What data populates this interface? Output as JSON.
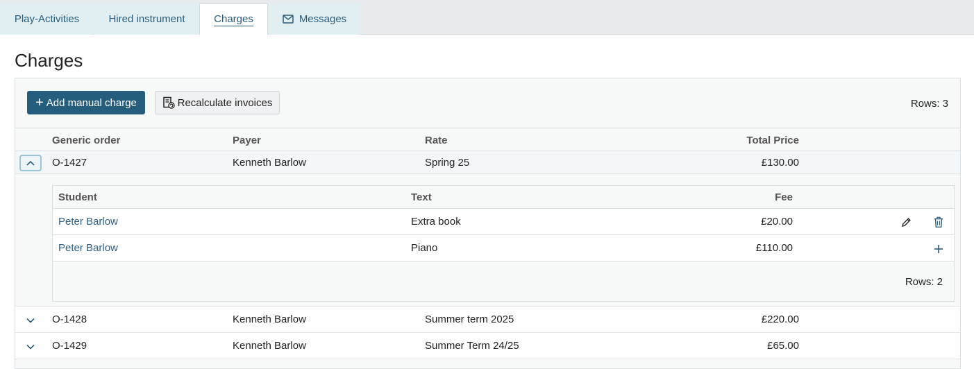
{
  "tabs": [
    {
      "label": "Play-Activities"
    },
    {
      "label": "Hired instrument"
    },
    {
      "label": "Charges"
    },
    {
      "label": "Messages"
    }
  ],
  "page": {
    "title": "Charges"
  },
  "toolbar": {
    "add_label": "Add manual charge",
    "recalc_label": "Recalculate invoices",
    "rows_count": "Rows: 3"
  },
  "table": {
    "headers": [
      "Generic order",
      "Payer",
      "Rate",
      "Total Price"
    ],
    "rows": [
      {
        "order": "O-1427",
        "payer": "Kenneth Barlow",
        "rate": "Spring 25",
        "total": "£130.00"
      },
      {
        "order": "O-1428",
        "payer": "Kenneth Barlow",
        "rate": "Summer term 2025",
        "total": "£220.00"
      },
      {
        "order": "O-1429",
        "payer": "Kenneth Barlow",
        "rate": "Summer Term 24/25",
        "total": "£65.00"
      }
    ]
  },
  "subtable": {
    "headers": [
      "Student",
      "Text",
      "Fee"
    ],
    "rows": [
      {
        "student": "Peter Barlow",
        "text": "Extra book",
        "fee": "£20.00"
      },
      {
        "student": "Peter Barlow",
        "text": "Piano",
        "fee": "£110.00"
      }
    ],
    "rows_count": "Rows: 2"
  },
  "icons": {
    "messages": "envelope-icon",
    "recalc": "invoice-refresh-icon",
    "edit": "pencil-icon",
    "delete": "trash-icon",
    "add": "plus-icon",
    "collapse": "chevron-up-icon",
    "expand": "chevron-down-icon"
  },
  "colors": {
    "accent": "#255e7d",
    "link": "#2d5f85",
    "tab_bg": "#e1eef2"
  }
}
